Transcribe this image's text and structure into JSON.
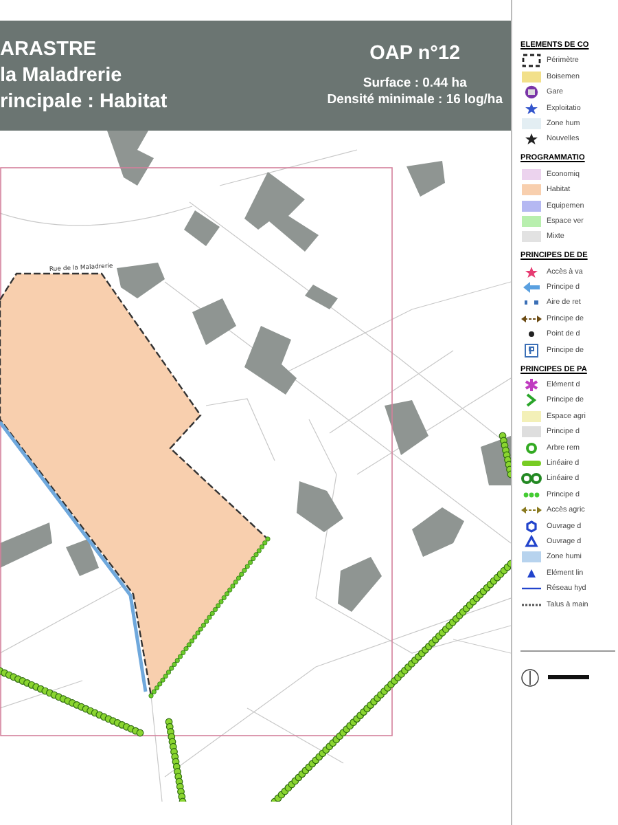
{
  "header": {
    "title_lines": [
      "ARASTRE",
      "la Maladrerie",
      "rincipale : Habitat"
    ],
    "oap": "OAP n°12",
    "surface": "Surface : 0.44 ha",
    "density": "Densité minimale : 16 log/ha"
  },
  "map": {
    "street_labels": [
      "Rue de la Maladrerie"
    ]
  },
  "legend": {
    "sections": [
      {
        "title": "ELEMENTS DE CO",
        "items": [
          {
            "kind": "dashed-rect",
            "label": "Périmètre"
          },
          {
            "kind": "fill",
            "color": "#f2e08a",
            "label": "Boisemen"
          },
          {
            "kind": "gare",
            "color": "#7a35a8",
            "label": "Gare"
          },
          {
            "kind": "star",
            "color": "#3355cc",
            "label": "Exploitatio"
          },
          {
            "kind": "fill",
            "color": "#e3eef3",
            "label": "Zone hum"
          },
          {
            "kind": "star",
            "color": "#222222",
            "label": "Nouvelles"
          }
        ]
      },
      {
        "title": "PROGRAMMATIO",
        "items": [
          {
            "kind": "fill",
            "color": "#ecd3ee",
            "label": "Economiq"
          },
          {
            "kind": "fill",
            "color": "#f8cfae",
            "label": "Habitat"
          },
          {
            "kind": "fill",
            "color": "#b5b8f2",
            "label": "Equipemen"
          },
          {
            "kind": "fill",
            "color": "#b8efae",
            "label": "Espace ver"
          },
          {
            "kind": "fill",
            "color": "#e2e2e2",
            "label": "Mixte"
          }
        ]
      },
      {
        "title": "PRINCIPES DE DE",
        "items": [
          {
            "kind": "star",
            "color": "#e63c72",
            "label": "Accès à va"
          },
          {
            "kind": "arrow",
            "color": "#5aa0e0",
            "label": "Principe d"
          },
          {
            "kind": "dashes",
            "color": "#3b6fb6",
            "label": "Aire de ret"
          },
          {
            "kind": "double-arrow",
            "color": "#6b4a12",
            "label": "Principe de"
          },
          {
            "kind": "point",
            "color": "#222222",
            "label": "Point de d"
          },
          {
            "kind": "parking",
            "color": "#3b6fb6",
            "label": "Principe de"
          }
        ]
      },
      {
        "title": "PRINCIPES DE PA",
        "items": [
          {
            "kind": "asterisk",
            "color": "#c03cc0",
            "label": "Elément d"
          },
          {
            "kind": "chevron",
            "color": "#2aa52a",
            "label": "Principe de"
          },
          {
            "kind": "fill",
            "color": "#f3f0b8",
            "label": "Espace agri"
          },
          {
            "kind": "fill",
            "color": "#dedede",
            "label": "Principe d"
          },
          {
            "kind": "ring",
            "color": "#33aa22",
            "label": "Arbre rem"
          },
          {
            "kind": "hedge",
            "color": "#77cc22",
            "label": "Linéaire d"
          },
          {
            "kind": "ring-pair",
            "color": "#228822",
            "label": "Linéaire d"
          },
          {
            "kind": "dots",
            "color": "#44cc33",
            "label": "Principe d"
          },
          {
            "kind": "double-arrow",
            "color": "#8a7a20",
            "label": "Accès agric"
          },
          {
            "kind": "hex",
            "color": "#2244cc",
            "label": "Ouvrage d"
          },
          {
            "kind": "tri-ring",
            "color": "#2244cc",
            "label": "Ouvrage d"
          },
          {
            "kind": "fill",
            "color": "#b7d3ee",
            "label": "Zone humi"
          },
          {
            "kind": "triangle",
            "color": "#2244cc",
            "label": "Elément lin"
          },
          {
            "kind": "line",
            "color": "#2244cc",
            "label": "Réseau hyd"
          },
          {
            "kind": "dotted",
            "color": "#555555",
            "label": "Talus à main"
          }
        ]
      }
    ]
  }
}
